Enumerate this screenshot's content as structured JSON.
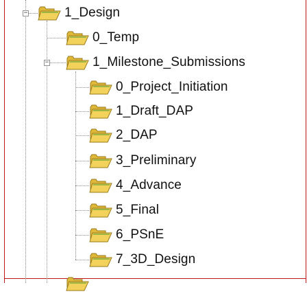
{
  "tree": {
    "expander_glyph": "−",
    "root": {
      "label": "1_Design"
    },
    "level1": [
      {
        "label": "0_Temp",
        "expandable": false
      },
      {
        "label": "1_Milestone_Submissions",
        "expandable": true
      }
    ],
    "milestones": [
      {
        "label": "0_Project_Initiation"
      },
      {
        "label": "1_Draft_DAP"
      },
      {
        "label": "2_DAP"
      },
      {
        "label": "3_Preliminary"
      },
      {
        "label": "4_Advance"
      },
      {
        "label": "5_Final"
      },
      {
        "label": "6_PSnE"
      },
      {
        "label": "7_3D_Design"
      }
    ]
  },
  "colors": {
    "folder_fill": "#f2d25a",
    "folder_back": "#e0b93a",
    "folder_stroke": "#9a7a1a",
    "folder_accent": "#7fae3e",
    "border": "#c01818"
  },
  "icons": {
    "folder": "folder-icon",
    "expander": "collapse-icon"
  }
}
